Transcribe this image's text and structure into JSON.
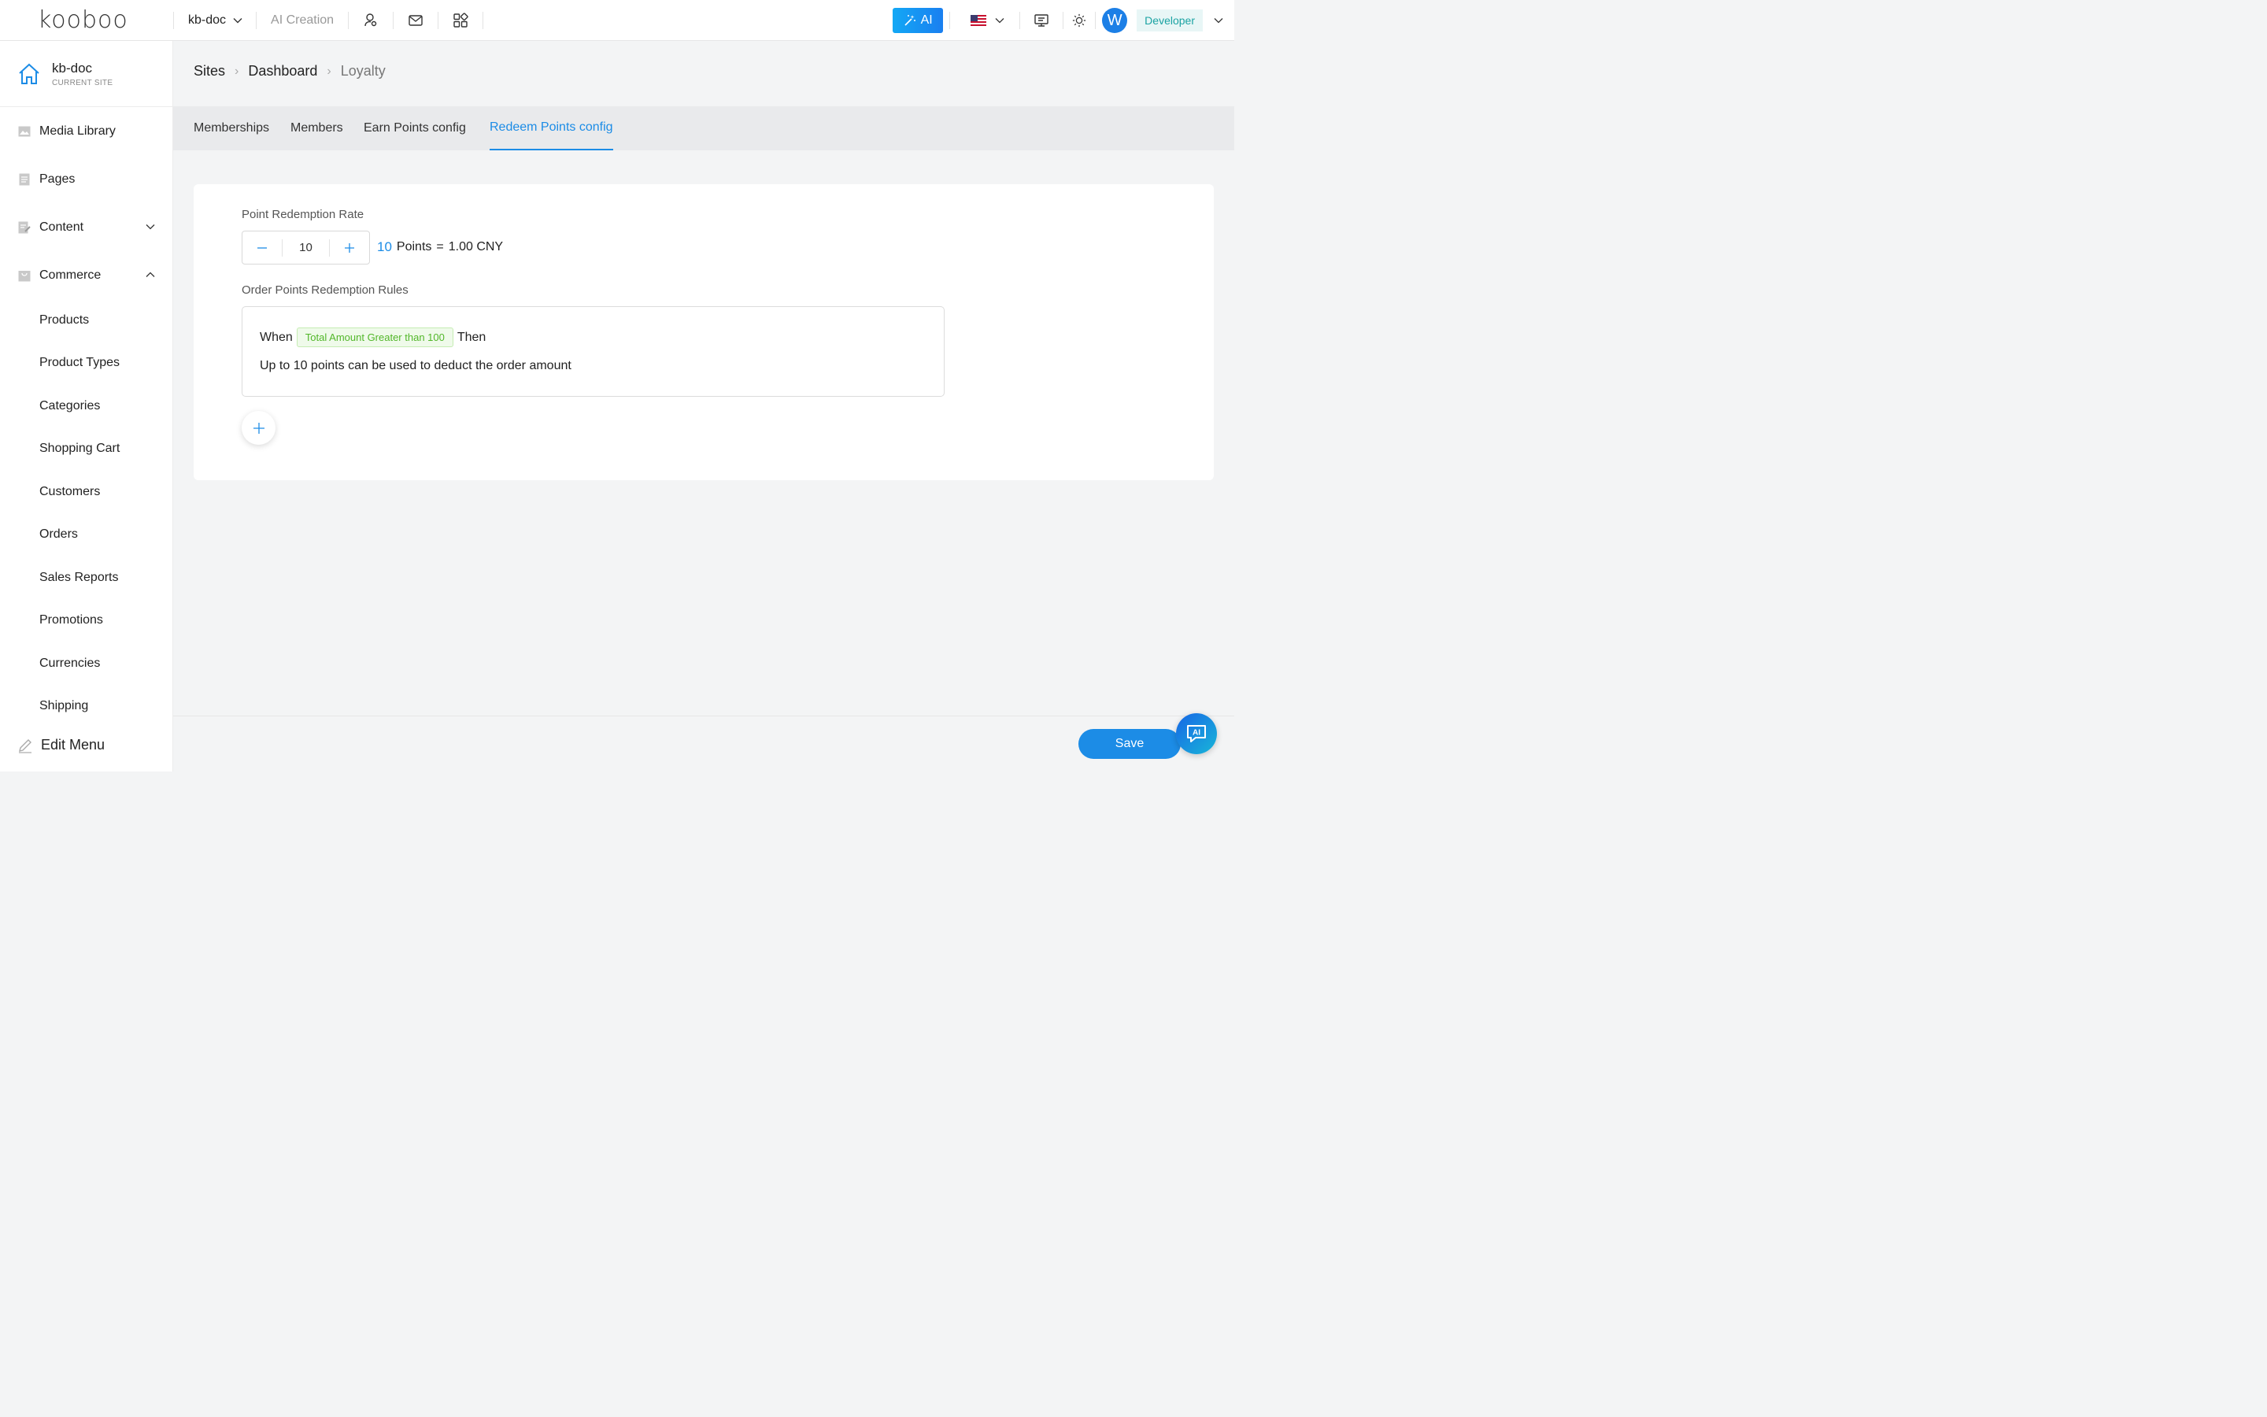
{
  "brand": {
    "logo_text": "kooboo"
  },
  "topbar": {
    "site_name": "kb-doc",
    "ai_creation": "AI Creation",
    "ai_button": "AI",
    "avatar_letter": "W",
    "role": "Developer"
  },
  "sidebar": {
    "current_site": {
      "name": "kb-doc",
      "caption": "CURRENT SITE"
    },
    "items": [
      {
        "label": "Media Library"
      },
      {
        "label": "Pages"
      },
      {
        "label": "Content"
      },
      {
        "label": "Commerce"
      }
    ],
    "commerce_sub": [
      {
        "label": "Products"
      },
      {
        "label": "Product Types"
      },
      {
        "label": "Categories"
      },
      {
        "label": "Shopping Cart"
      },
      {
        "label": "Customers"
      },
      {
        "label": "Orders"
      },
      {
        "label": "Sales Reports"
      },
      {
        "label": "Promotions"
      },
      {
        "label": "Currencies"
      },
      {
        "label": "Shipping"
      }
    ],
    "edit_menu": "Edit Menu"
  },
  "breadcrumb": {
    "items": [
      "Sites",
      "Dashboard",
      "Loyalty"
    ]
  },
  "tabs": {
    "items": [
      "Memberships",
      "Members",
      "Earn Points config",
      "Redeem Points config"
    ],
    "active_index": 3
  },
  "redeem": {
    "rate_label": "Point Redemption Rate",
    "stepper_value": "10",
    "rate_points": "10",
    "rate_points_unit": "Points",
    "rate_equals": "=",
    "rate_amount": "1.00 CNY",
    "rules_label": "Order Points Redemption Rules",
    "rule_when": "When",
    "rule_condition": "Total Amount Greater than 100",
    "rule_then": "Then",
    "rule_action": "Up to 10 points can be used to deduct the order amount"
  },
  "footer": {
    "save_label": "Save",
    "ai_float_label": "AI"
  },
  "colors": {
    "accent": "#1c8ce6",
    "tag_green": "#52b72a",
    "role_teal": "#1ba3a3"
  }
}
